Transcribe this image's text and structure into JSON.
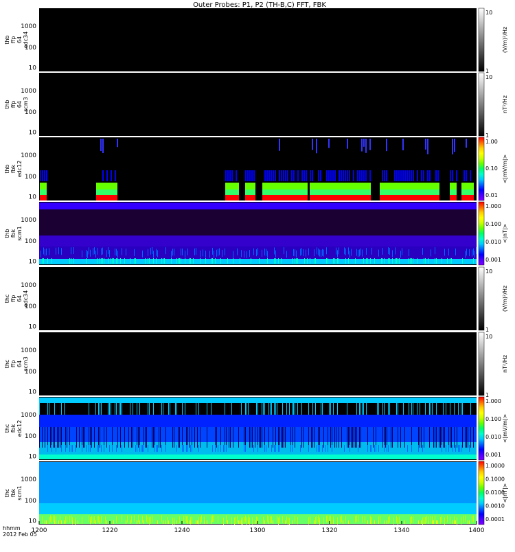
{
  "title": "Outer Probes: P1, P2 (TH-B,C) FFT, FBK",
  "time_axis": {
    "ticks": [
      "1200",
      "1220",
      "1240",
      "1300",
      "1320",
      "1340",
      "1400"
    ],
    "label_line1": "hhmm",
    "label_line2": "2012 Feb 05"
  },
  "colors": {
    "background": "#000000",
    "frame": "#000000",
    "separator": "#ffffff"
  },
  "chart_data": [
    {
      "type": "heatmap",
      "panel": "thb ffp 64 edc34",
      "ylabel": [
        "thb",
        "ffp",
        "64",
        "edc34"
      ],
      "yticks": [
        "1000",
        "100",
        "10"
      ],
      "cbar_ticks": [
        "10",
        "1"
      ],
      "cbar_label": "(V/m)²/Hz",
      "cbar_type": "bw",
      "fill": "empty"
    },
    {
      "type": "heatmap",
      "panel": "thb ffp 64 scm3",
      "ylabel": [
        "thb",
        "ffp",
        "64",
        "scm3"
      ],
      "yticks": [
        "1000",
        "100",
        "10"
      ],
      "cbar_ticks": [
        "10",
        "1"
      ],
      "cbar_label": "nT²/Hz",
      "cbar_type": "bw",
      "fill": "empty"
    },
    {
      "type": "heatmap",
      "panel": "thb fbk edc12",
      "ylabel": [
        "thb",
        "fbk",
        "edc12"
      ],
      "yticks": [
        "1000",
        "100",
        "10"
      ],
      "cbar_ticks": [
        "1.00",
        "0.10",
        "0.01"
      ],
      "cbar_label": "<|mV/m|>",
      "cbar_type": "rainbow",
      "fill": "sparse"
    },
    {
      "type": "heatmap",
      "panel": "thb fbk scm1",
      "ylabel": [
        "thb",
        "fbk",
        "scm1"
      ],
      "yticks": [
        "1000",
        "100",
        "10"
      ],
      "cbar_ticks": [
        "1.000",
        "0.100",
        "0.010",
        "0.001"
      ],
      "cbar_label": "<|nT|>",
      "cbar_type": "rainbow",
      "fill": "scm_b"
    },
    {
      "type": "heatmap",
      "panel": "thc ffp 64 edc34",
      "ylabel": [
        "thc",
        "ffp",
        "64",
        "edc34"
      ],
      "yticks": [
        "1000",
        "100",
        "10"
      ],
      "cbar_ticks": [
        "10",
        "1"
      ],
      "cbar_label": "(V/m)²/Hz",
      "cbar_type": "bw",
      "fill": "empty"
    },
    {
      "type": "heatmap",
      "panel": "thc ffp 64 scm3",
      "ylabel": [
        "thc",
        "ffp",
        "64",
        "scm3"
      ],
      "yticks": [
        "1000",
        "100",
        "10"
      ],
      "cbar_ticks": [
        "10",
        "1"
      ],
      "cbar_label": "nT²/Hz",
      "cbar_type": "bw",
      "fill": "empty"
    },
    {
      "type": "heatmap",
      "panel": "thc fbk edc12",
      "ylabel": [
        "thc",
        "fbk",
        "edc12"
      ],
      "yticks": [
        "1000",
        "100",
        "10"
      ],
      "cbar_ticks": [
        "1.000",
        "0.100",
        "0.010",
        "0.001"
      ],
      "cbar_label": "<|mV/m|>",
      "cbar_type": "rainbow",
      "fill": "edc_c"
    },
    {
      "type": "heatmap",
      "panel": "thc fbk scm1",
      "ylabel": [
        "thc",
        "fbk",
        "scm1"
      ],
      "yticks": [
        "1000",
        "100",
        "10"
      ],
      "cbar_ticks": [
        "1.0000",
        "0.1000",
        "0.0100",
        "0.0010",
        "0.0001"
      ],
      "cbar_label": "<|nT|>",
      "cbar_type": "rainbow",
      "fill": "scm_c"
    }
  ]
}
